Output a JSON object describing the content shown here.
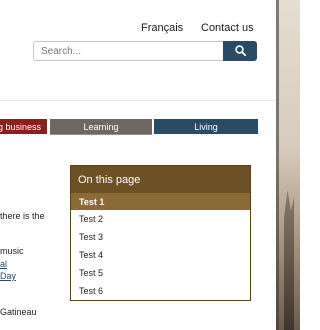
{
  "header": {
    "language_link": "Français",
    "contact_link": "Contact us"
  },
  "search": {
    "placeholder": "Search..."
  },
  "nav": {
    "tabs": [
      {
        "label": "ng business",
        "color": "#8e1d1d"
      },
      {
        "label": "Learning",
        "color": "#6f6764"
      },
      {
        "label": "Living",
        "color": "#2b4a63"
      }
    ]
  },
  "body_fragments": {
    "line1": "there is the",
    "line2": "music",
    "line3_link": "al",
    "line4_link": "Day",
    "line5": "Gatineau"
  },
  "on_this_page": {
    "title": "On this page",
    "items": [
      "Test 1",
      "Test 2",
      "Test 3",
      "Test 4",
      "Test 5",
      "Test 6"
    ],
    "active_index": 0,
    "header_color": "#6e5025",
    "active_color": "#8a6a35"
  },
  "icons": {
    "search": "magnifier-icon"
  }
}
